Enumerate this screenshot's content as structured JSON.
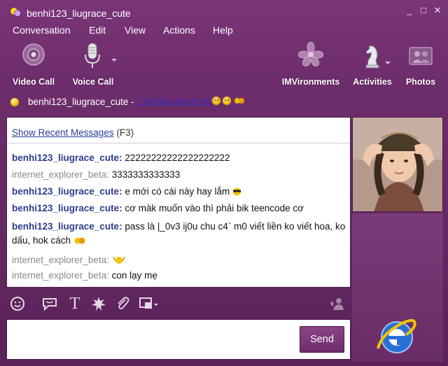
{
  "window": {
    "title": "benhi123_liugrace_cute",
    "controls": [
      "_",
      "□",
      "✕"
    ]
  },
  "menu": [
    "Conversation",
    "Edit",
    "View",
    "Actions",
    "Help"
  ],
  "toolbar": {
    "video_call": "Video Call",
    "voice_call": "Voice Call",
    "imvironments": "IMVironments",
    "activities": "Activities",
    "photos": "Photos"
  },
  "status": {
    "contact_name": "benhi123_liugrace_cute -",
    "status_message": "|_0v3 ij0u chu c4` m0"
  },
  "chat": {
    "show_recent": "Show Recent Messages",
    "shortcut": "(F3)",
    "messages": [
      {
        "sender": "benhi123_liugrace_cute:",
        "text": "22222222222222222222",
        "kind": "a"
      },
      {
        "sender": "internet_explorer_beta:",
        "text": "3333333333333",
        "kind": "b"
      },
      {
        "sender": "benhi123_liugrace_cute:",
        "text": "e mới có cái này hay lắm",
        "kind": "a"
      },
      {
        "sender": "benhi123_liugrace_cute:",
        "text": "cơ màk muốn vào thì phải bik teencode cơ",
        "kind": "a"
      },
      {
        "sender": "benhi123_liugrace_cute:",
        "text": "pass là |_0v3 ij0u chu c4` m0 viết liền ko viết hoa, ko dấu, hok cách",
        "kind": "a"
      },
      {
        "sender": "internet_explorer_beta:",
        "text": "",
        "kind": "b"
      },
      {
        "sender": "internet_explorer_beta:",
        "text": "con lạy mẹ",
        "kind": "b"
      }
    ]
  },
  "composer": {
    "send_label": "Send"
  },
  "colors": {
    "window_bg": "#6e2d6c",
    "sender_self": "#2d3c8e",
    "sender_other": "#8a8a8a"
  },
  "icons": [
    "emoticon-icon",
    "voice-bubble-icon",
    "text-format-icon",
    "buzz-icon",
    "attach-icon",
    "imvironment-select-icon",
    "contact-panel-icon"
  ]
}
